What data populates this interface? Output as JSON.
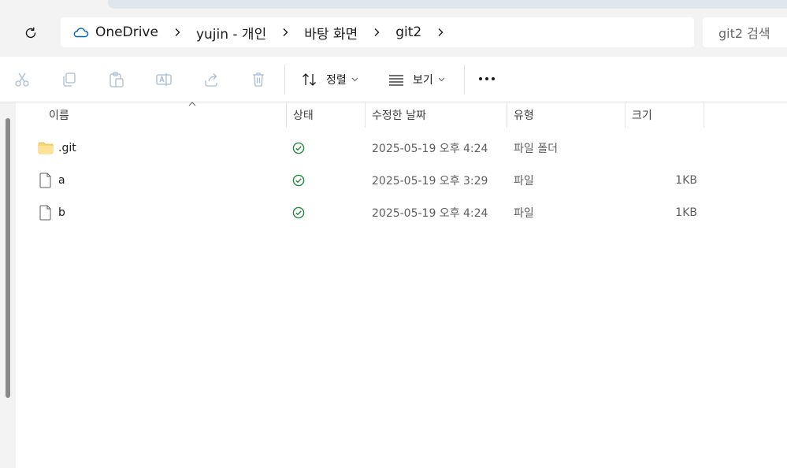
{
  "address_bar": {
    "crumbs": [
      {
        "label": "OneDrive"
      },
      {
        "label": "yujin - 개인"
      },
      {
        "label": "바탕 화면"
      },
      {
        "label": "git2"
      }
    ],
    "search_placeholder": "git2 검색"
  },
  "command_bar": {
    "sort_label": "정렬",
    "view_label": "보기"
  },
  "columns": {
    "name": "이름",
    "status": "상태",
    "modified": "수정한 날짜",
    "type": "유형",
    "size": "크기"
  },
  "files": [
    {
      "name": ".git",
      "modified": "2025-05-19 오후 4:24",
      "type": "파일 폴더",
      "size": "",
      "icon": "folder-icon"
    },
    {
      "name": "a",
      "modified": "2025-05-19 오후 3:29",
      "type": "파일",
      "size": "1KB",
      "icon": "file-icon"
    },
    {
      "name": "b",
      "modified": "2025-05-19 오후 4:24",
      "type": "파일",
      "size": "1KB",
      "icon": "file-icon"
    }
  ],
  "colors": {
    "sync_ok": "#1e8a3a",
    "accent": "#0067c0",
    "folder": "#f5d27a"
  }
}
